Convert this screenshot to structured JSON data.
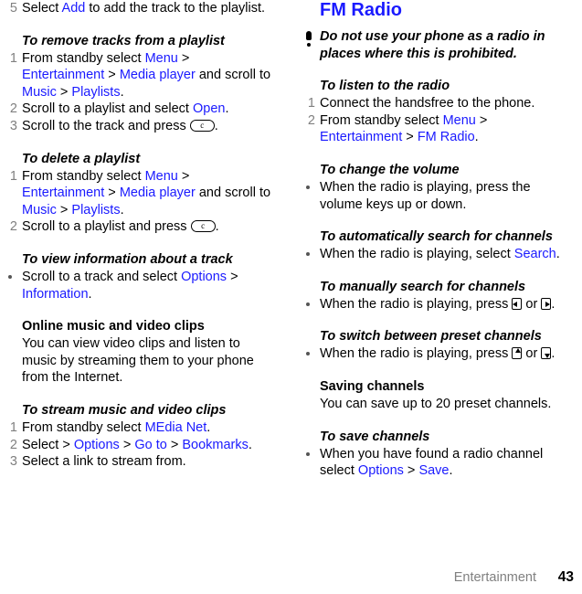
{
  "document": {
    "footer": {
      "section": "Entertainment",
      "page_number": "43"
    },
    "colors": {
      "link": "#1a1aff",
      "heading": "#1a1aff",
      "list_marker": "#808080",
      "body": "#000000"
    }
  },
  "left_column": {
    "continued_step": {
      "num": "5",
      "t1": "Select ",
      "l1": "Add",
      "t2": " to add the track to the playlist."
    },
    "section_remove_tracks": {
      "heading": "To remove tracks from a playlist",
      "steps": [
        {
          "num": "1",
          "t1": "From standby select ",
          "l1": "Menu",
          "t2": " > ",
          "l2": "Entertainment",
          "t3": " > ",
          "l3": "Media player",
          "t4": " and scroll to ",
          "l4": "Music",
          "t5": " > ",
          "l5": "Playlists",
          "t6": "."
        },
        {
          "num": "2",
          "t1": "Scroll to a playlist and select ",
          "l1": "Open",
          "t2": "."
        },
        {
          "num": "3",
          "t1": "Scroll to the track and press ",
          "key": "c",
          "t2": "."
        }
      ]
    },
    "section_delete_playlist": {
      "heading": "To delete a playlist",
      "steps": [
        {
          "num": "1",
          "t1": "From standby select ",
          "l1": "Menu",
          "t2": " > ",
          "l2": "Entertainment",
          "t3": " > ",
          "l3": "Media player",
          "t4": " and scroll to ",
          "l4": "Music",
          "t5": " > ",
          "l5": "Playlists",
          "t6": "."
        },
        {
          "num": "2",
          "t1": "Scroll to a playlist and press ",
          "key": "c",
          "t2": "."
        }
      ]
    },
    "section_view_info": {
      "heading": "To view information about a track",
      "bullet": {
        "t1": "Scroll to a track and select ",
        "l1": "Options",
        "t2": " > ",
        "l2": "Information",
        "t3": "."
      }
    },
    "section_online_clips": {
      "heading": "Online music and video clips",
      "body": "You can view video clips and listen to music by streaming them to your phone from the Internet."
    },
    "section_stream": {
      "heading": "To stream music and video clips",
      "steps": [
        {
          "num": "1",
          "t1": "From standby select ",
          "l1": "MEdia Net",
          "t2": "."
        },
        {
          "num": "2",
          "t1": "Select > ",
          "l1": "Options",
          "t2": " > ",
          "l2": "Go to",
          "t3": " > ",
          "l3": "Bookmarks",
          "t4": "."
        },
        {
          "num": "3",
          "t1": "Select a link to stream from.",
          "t2": ""
        }
      ]
    }
  },
  "right_column": {
    "chapter_title": "FM Radio",
    "note": {
      "icon": "exclamation-icon",
      "text": "Do not use your phone as a radio in places where this is prohibited."
    },
    "section_listen": {
      "heading": "To listen to the radio",
      "steps": [
        {
          "num": "1",
          "t1": "Connect the handsfree to the phone."
        },
        {
          "num": "2",
          "t1": "From standby select ",
          "l1": "Menu",
          "t2": " > ",
          "l2": "Entertainment",
          "t3": " > ",
          "l3": "FM Radio",
          "t4": "."
        }
      ]
    },
    "section_volume": {
      "heading": "To change the volume",
      "bullet": {
        "t1": "When the radio is playing, press the volume keys up or down."
      }
    },
    "section_auto_search": {
      "heading": "To automatically search for channels",
      "bullet": {
        "t1": "When the radio is playing, select ",
        "l1": "Search",
        "t2": "."
      }
    },
    "section_manual_search": {
      "heading": "To manually search for channels",
      "bullet": {
        "t1": "When the radio is playing, press ",
        "key1": "left-arrow-key",
        "t2": " or ",
        "key2": "right-arrow-key",
        "t3": "."
      }
    },
    "section_preset_switch": {
      "heading": "To switch between preset channels",
      "bullet": {
        "t1": "When the radio is playing, press ",
        "key1": "up-arrow-key",
        "t2": " or ",
        "key2": "down-arrow-key",
        "t3": "."
      }
    },
    "section_saving": {
      "heading": "Saving channels",
      "body": "You can save up to 20 preset channels."
    },
    "section_save": {
      "heading": "To save channels",
      "bullet": {
        "t1": "When you have found a radio channel select ",
        "l1": "Options",
        "t2": " > ",
        "l2": "Save",
        "t3": "."
      }
    }
  }
}
